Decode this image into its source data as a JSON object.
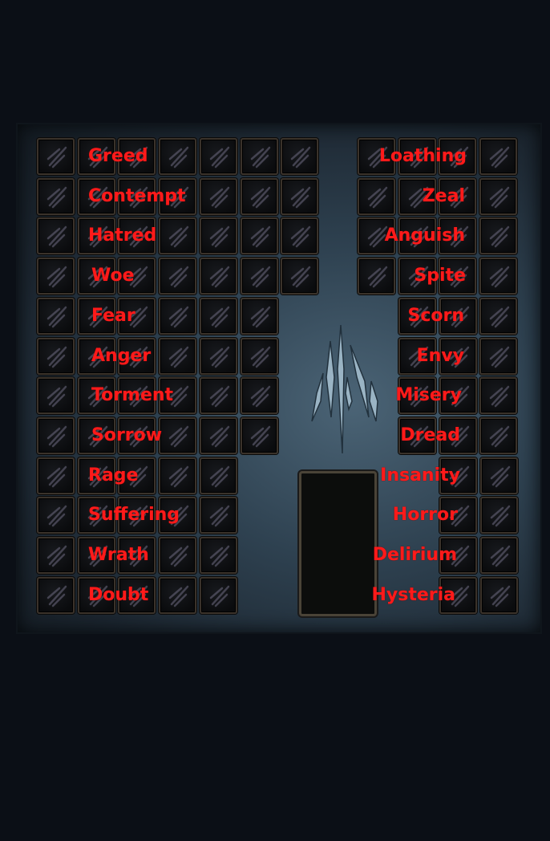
{
  "stash": {
    "left_labels": [
      "Greed",
      "Contempt",
      "Hatred",
      "Woe",
      "Fear",
      "Anger",
      "Torment",
      "Sorrow",
      "Rage",
      "Suffering",
      "Wrath",
      "Doubt"
    ],
    "right_labels": [
      "Loathing",
      "Zeal",
      "Anguish",
      "Spite",
      "Scorn",
      "Envy",
      "Misery",
      "Dread",
      "Insanity",
      "Horror",
      "Delirium",
      "Hysteria"
    ],
    "label_color": "#ff1a1a",
    "emblem_icon": "essence-claw-icon",
    "slot_icon": "remnant-of-corruption-slot"
  }
}
